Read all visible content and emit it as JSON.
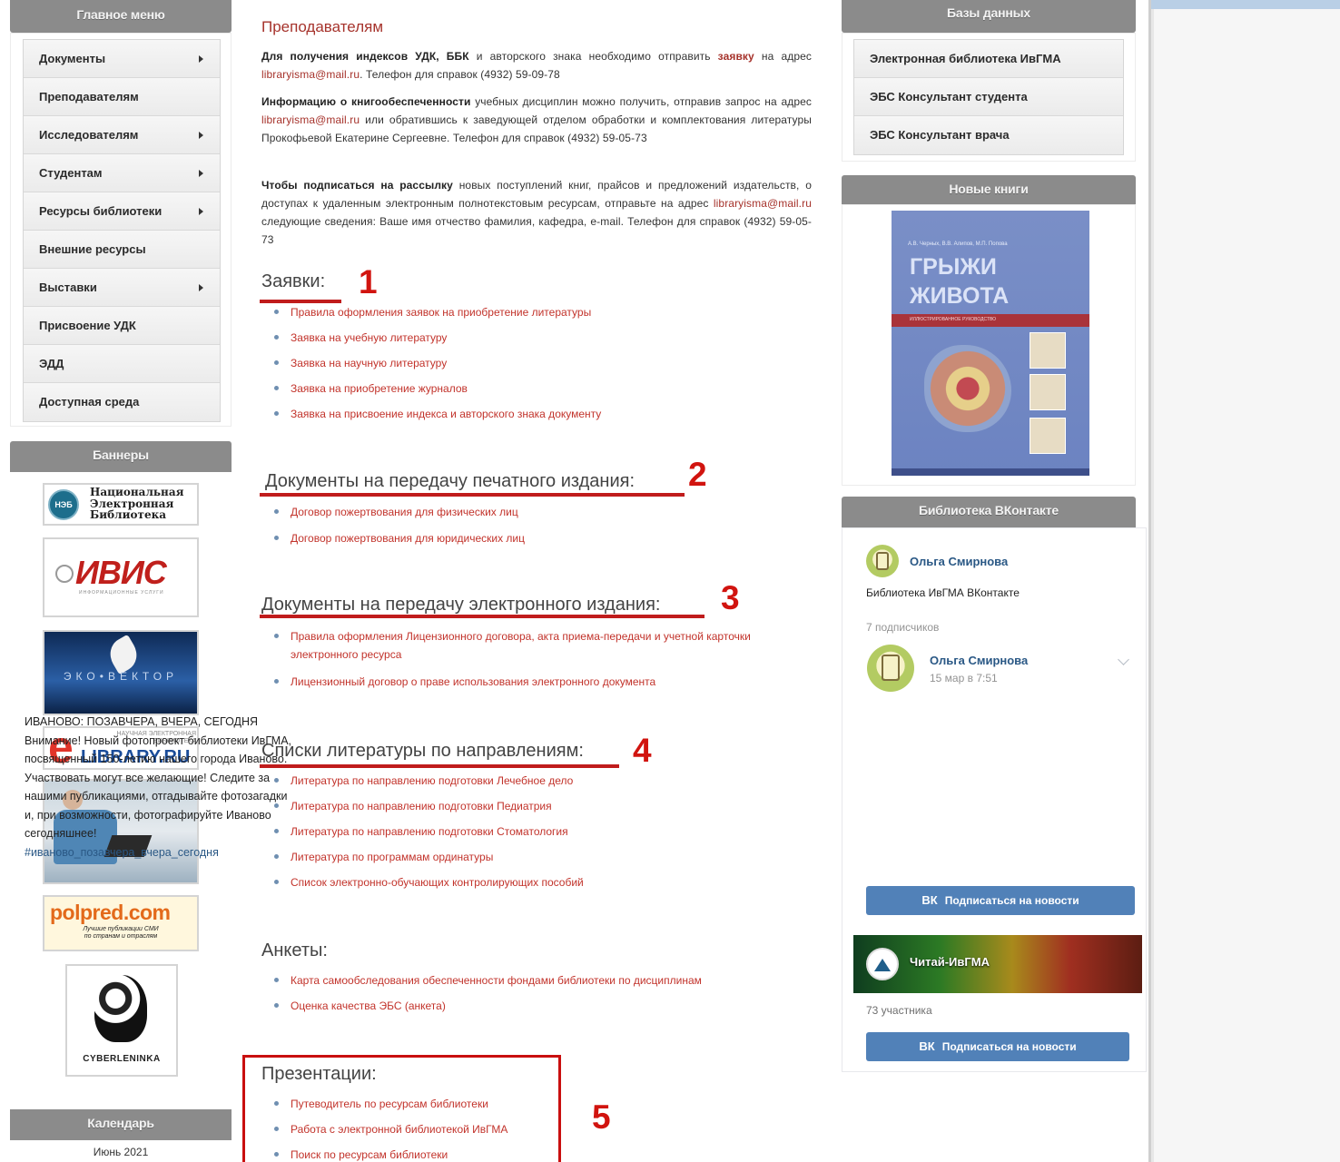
{
  "main_menu": {
    "title": "Главное меню",
    "items": [
      {
        "label": "Документы",
        "has_submenu": true
      },
      {
        "label": "Преподавателям",
        "has_submenu": false
      },
      {
        "label": "Исследователям",
        "has_submenu": true
      },
      {
        "label": "Студентам",
        "has_submenu": true
      },
      {
        "label": "Ресурсы библиотеки",
        "has_submenu": true
      },
      {
        "label": "Внешние ресурсы",
        "has_submenu": false
      },
      {
        "label": "Выставки",
        "has_submenu": true
      },
      {
        "label": "Присвоение УДК",
        "has_submenu": false
      },
      {
        "label": "ЭДД",
        "has_submenu": false
      },
      {
        "label": "Доступная среда",
        "has_submenu": false
      }
    ]
  },
  "banners": {
    "title": "Баннеры",
    "neb": {
      "badge": "НЭБ",
      "line1": "Национальная",
      "line2": "Электронная",
      "line3": "Библиотека"
    },
    "ivis": {
      "name": "ИВИС",
      "tagline": "ИНФОРМАЦИОННЫЕ УСЛУГИ"
    },
    "eco": {
      "name": "ЭКО•ВЕКТОР"
    },
    "elibrary": {
      "top": "НАУЧНАЯ ЭЛЕКТРОННАЯ БИБЛИОТЕКА",
      "name": "LIBRARY.RU",
      "letter": "e"
    },
    "polpred": {
      "name": "polpred.com",
      "line1": "Лучшие публикации СМИ",
      "line2": "по странам и отраслям"
    },
    "cyberleninka": {
      "name": "CYBERLENINKA"
    }
  },
  "calendar": {
    "title": "Календарь",
    "month": "Июнь 2021"
  },
  "center": {
    "page_title": "Преподавателям",
    "para1": {
      "bold": "Для получения индексов УДК, ББК",
      "text1": " и авторского знака необходимо отправить ",
      "link": "заявку",
      "text2": " на адрес ",
      "email": "libraryisma@mail.ru",
      "text3": ". Телефон для справок (4932) 59-09-78"
    },
    "para2": {
      "bold": "Информацию о книгообеспеченности",
      "text1": " учебных дисциплин можно получить, отправив запрос на адрес ",
      "email": "libraryisma@mail.ru",
      "text2": " или обратившись к заведующей отделом обработки и комплектования литературы Прокофьевой Екатерине Сергеевне. Телефон для справок (4932) 59-05-73"
    },
    "para3": {
      "bold": "Чтобы подписаться на рассылку",
      "text1": " новых поступлений книг, прайсов и предложений издательств, о доступах к удаленным электронным полнотекстовым ресурсам, отправьте на адрес ",
      "email": "libraryisma@mail.ru",
      "text2": " следующие сведения: Ваше имя отчество фамилия, кафедра, e-mail. Телефон для справок (4932) 59-05-73"
    },
    "sections": [
      {
        "title": "Заявки:",
        "number": "1",
        "links": [
          "Правила оформления заявок на приобретение литературы",
          "Заявка на учебную литературу",
          "Заявка на научную литературу",
          "Заявка на приобретение журналов",
          "Заявка на присвоение индекса и авторского знака документу"
        ]
      },
      {
        "title": "Документы на передачу печатного издания:",
        "number": "2",
        "links": [
          "Договор пожертвования для физических лиц",
          "Договор пожертвования для юридических лиц"
        ]
      },
      {
        "title": "Документы на передачу электронного издания:",
        "number": "3",
        "links": [
          "Правила оформления Лицензионного договора, акта приема-передачи и учетной карточки электронного ресурса",
          "Лицензионный договор о праве использования электронного документа"
        ]
      },
      {
        "title": "Списки литературы по направлениям:",
        "number": "4",
        "links": [
          "Литература по направлению подготовки Лечебное дело",
          "Литература по направлению подготовки Педиатрия",
          "Литература по направлению подготовки Стоматология",
          "Литература по программам ординатуры",
          "Список электронно-обучающих контролирующих пособий"
        ]
      },
      {
        "title": "Анкеты:",
        "number": "",
        "links": [
          "Карта самообследования обеспеченности фондами библиотеки по дисциплинам",
          "Оценка качества ЭБС (анкета)"
        ]
      },
      {
        "title": "Презентации:",
        "number": "5",
        "links": [
          "Путеводитель по ресурсам библиотеки",
          "Работа с электронной библиотекой ИвГМА",
          "Поиск по ресурсам библиотеки"
        ]
      }
    ]
  },
  "databases": {
    "title": "Базы данных",
    "items": [
      "Электронная библиотека ИвГМА",
      "ЭБС Консультант студента",
      "ЭБС Консультант врача"
    ]
  },
  "new_books": {
    "title": "Новые книги",
    "book": {
      "authors": "А.В. Черных, В.В. Алипов, М.П. Попова",
      "title_line1": "ГРЫЖИ",
      "title_line2": "ЖИВОТА",
      "subtitle": "ИЛЛЮСТРИРОВАННОЕ РУКОВОДСТВО"
    }
  },
  "vk": {
    "title": "Библиотека ВКонтакте",
    "group_name": "Ольга Смирнова",
    "group_desc": "Библиотека ИвГМА ВКонтакте",
    "subscribers": "7 подписчиков",
    "post_author": "Ольга Смирнова",
    "post_date": "15 мар в 7:51",
    "post_title": "ИВАНОВО: ПОЗАВЧЕРА, ВЧЕРА, СЕГОДНЯ",
    "post_body": "Внимание! Новый фотопроект библиотеки ИвГМА, посвященный 150-летию нашего города Иваново. Участвовать могут все желающие! Следите за нашими публикациями, отгадывайте фотозагадки и, при возможности, фотографируйте Иваново сегодняшнее!",
    "post_hashtag": "#иваново_позавчера_вчера_сегодня",
    "subscribe_label": "Подписаться на новости",
    "vk_logo": "ВК",
    "group2_name": "Читай-ИвГМА",
    "group2_members": "73 участника",
    "subscribe2_label": "Подписаться на новости"
  }
}
